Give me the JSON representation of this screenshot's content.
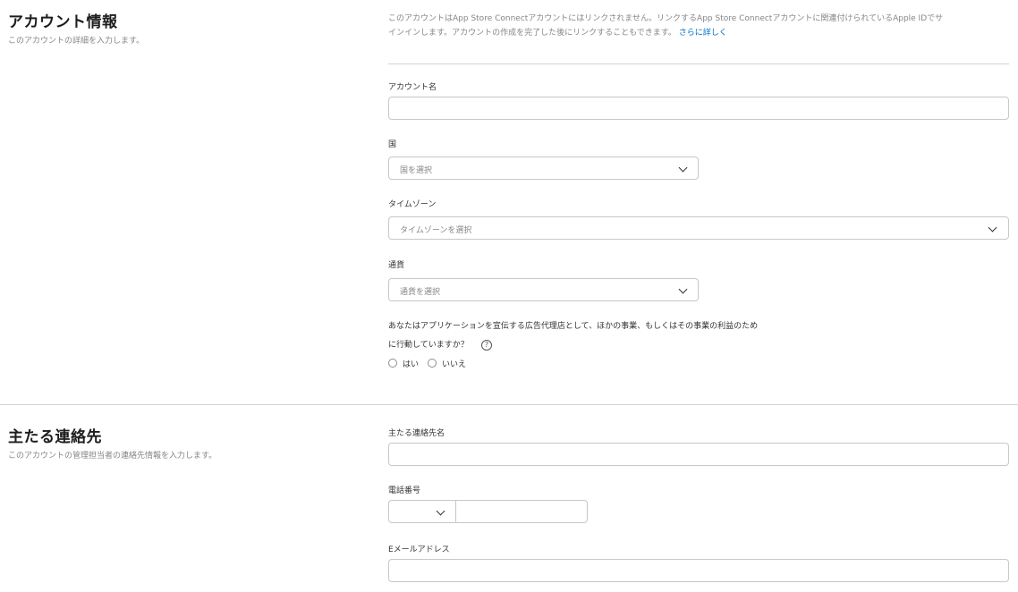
{
  "account_section": {
    "title": "アカウント情報",
    "subtitle": "このアカウントの詳細を入力します。",
    "intro_line1": "このアカウントはApp Store Connectアカウントにはリンクされません。リンクするApp Store Connectアカウントに関連付けられているApple IDでサ",
    "intro_line2": "インインします。アカウントの作成を完了した後にリンクすることもできます。",
    "learn_more": "さらに詳しく",
    "account_name_label": "アカウント名",
    "country_label": "国",
    "country_placeholder": "国を選択",
    "timezone_label": "タイムゾーン",
    "timezone_placeholder": "タイムゾーンを選択",
    "currency_label": "通貨",
    "currency_placeholder": "通貨を選択",
    "agency_question_line1": "あなたはアプリケーションを宣伝する広告代理店として、ほかの事業、もしくはその事業の利益のため",
    "agency_question_line2": "に行動していますか？",
    "help_glyph": "?",
    "yes_label": "はい",
    "no_label": "いいえ"
  },
  "contact_section": {
    "title": "主たる連絡先",
    "subtitle": "このアカウントの管理担当者の連絡先情報を入力します。",
    "contact_name_label": "主たる連絡先名",
    "phone_label": "電話番号",
    "email_label": "Eメールアドレス"
  },
  "icons": {
    "dropdown": "chevron-down-icon",
    "help": "question-circle-icon",
    "radio": "radio-button-icon"
  }
}
